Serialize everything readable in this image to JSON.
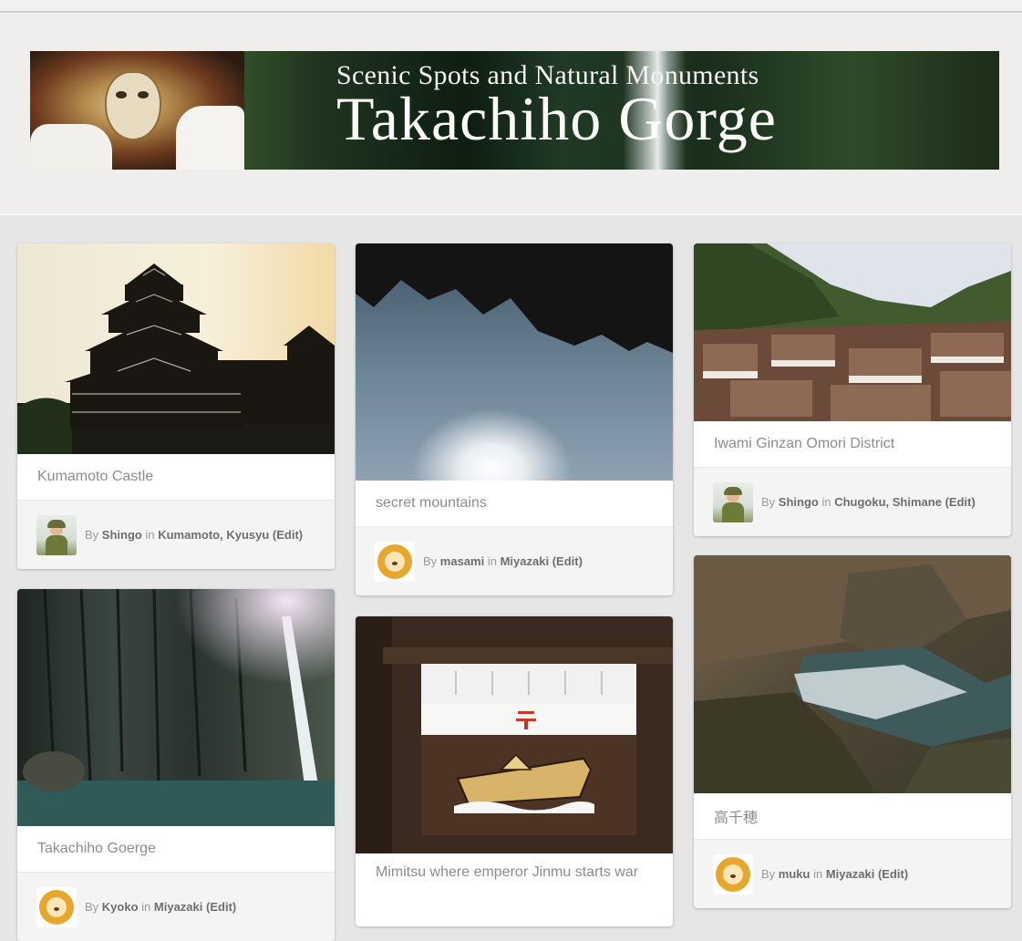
{
  "banner": {
    "subtitle": "Scenic Spots and Natural Monuments",
    "title": "Takachiho Gorge"
  },
  "cards": [
    {
      "title": "Kumamoto Castle",
      "by": "By",
      "author": "Shingo",
      "in": "in",
      "categories": "Kumamoto, Kyusyu",
      "edit": "(Edit)"
    },
    {
      "title": "secret mountains",
      "by": "By",
      "author": "masami",
      "in": "in",
      "categories": "Miyazaki",
      "edit": "(Edit)"
    },
    {
      "title": "Iwami Ginzan Omori District",
      "by": "By",
      "author": "Shingo",
      "in": "in",
      "categories": "Chugoku, Shimane",
      "edit": "(Edit)"
    },
    {
      "title": "Takachiho Goerge",
      "by": "By",
      "author": "Kyoko",
      "in": "in",
      "categories": "Miyazaki",
      "edit": "(Edit)"
    },
    {
      "title": "Mimitsu where emperor Jinmu starts war"
    },
    {
      "title": "高千穂",
      "by": "By",
      "author": "muku",
      "in": "in",
      "categories": "Miyazaki",
      "edit": "(Edit)"
    }
  ]
}
